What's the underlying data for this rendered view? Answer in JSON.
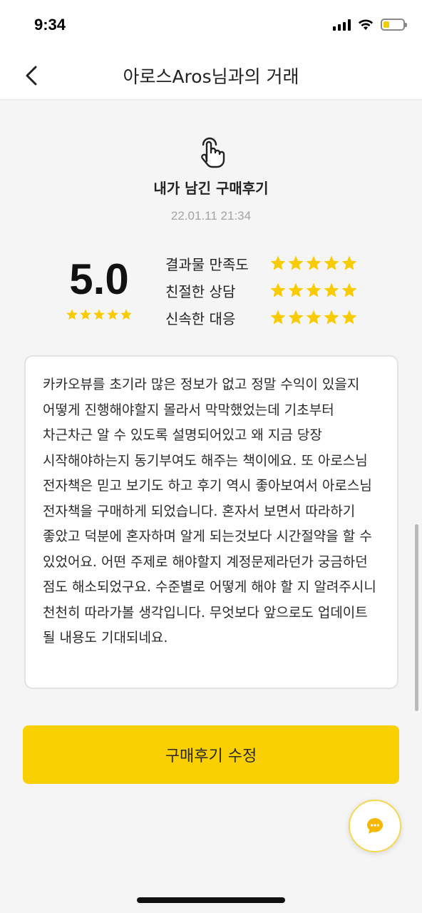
{
  "status_bar": {
    "time": "9:34",
    "battery_level": 0.3,
    "icons": [
      "signal-icon",
      "wifi-icon",
      "battery-icon"
    ]
  },
  "nav": {
    "back_icon": "chevron-left-icon",
    "title": "아로스Aros님과의 거래"
  },
  "review": {
    "icon": "tap-hand-icon",
    "title": "내가 남긴 구매후기",
    "date": "22.01.11 21:34",
    "score": "5.0",
    "overall_stars": 5,
    "ratings": [
      {
        "label": "결과물 만족도",
        "stars": 5
      },
      {
        "label": "친절한 상담",
        "stars": 5
      },
      {
        "label": "신속한 대응",
        "stars": 5
      }
    ],
    "text": "카카오뷰를 초기라 많은 정보가 없고 정말 수익이 있을지 어떻게 진행해야할지 몰라서 막막했었는데 기초부터 차근차근 알 수 있도록 설명되어있고 왜 지금 당장 시작해야하는지 동기부여도 해주는 책이에요. 또 아로스님 전자책은 믿고 보기도 하고 후기 역시 좋아보여서 아로스님 전자책을 구매하게 되었습니다. 혼자서 보면서 따라하기 좋았고 덕분에 혼자하며 알게 되는것보다 시간절약을 할 수 있었어요. 어떤 주제로 해야할지 계정문제라던가 궁금하던 점도 해소되었구요. 수준별로 어떻게 해야 할 지 알려주시니 천천히 따라가볼 생각입니다.  무엇보다 앞으로도 업데이트 될 내용도 기대되네요."
  },
  "actions": {
    "edit_label": "구매후기 수정",
    "chat_icon": "chat-bubble-icon"
  },
  "colors": {
    "accent": "#fbd000",
    "star": "#f8cc00",
    "background": "#f5f5f6",
    "date_text": "#a3a3a8"
  }
}
